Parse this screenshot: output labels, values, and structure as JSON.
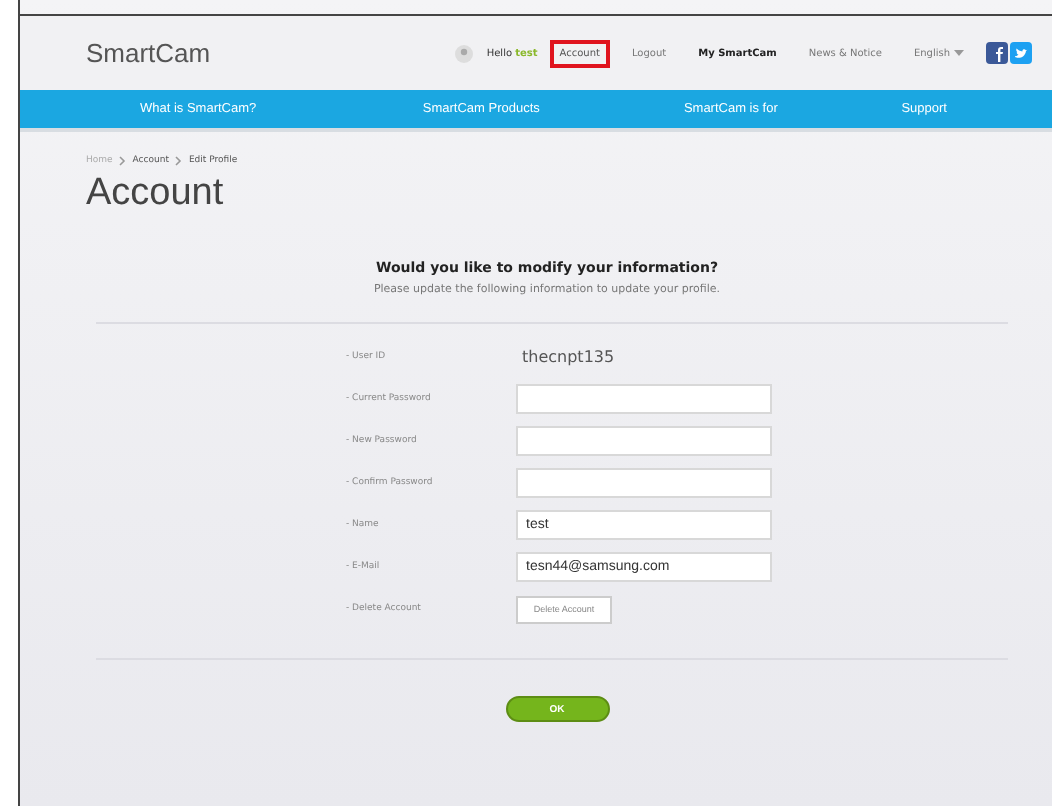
{
  "logo": "SmartCam",
  "header_links": [
    {
      "kind": "icon"
    },
    {
      "kind": "greeting",
      "label": "Hello",
      "user": "test"
    },
    {
      "kind": "link",
      "label": "Account",
      "selected": true
    },
    {
      "kind": "link",
      "label": "Logout",
      "selected": false
    },
    {
      "kind": "bold",
      "label": "My SmartCam"
    },
    {
      "kind": "link",
      "label": "News & Notice",
      "selected": false
    },
    {
      "kind": "dropdown",
      "label": "English"
    },
    {
      "kind": "social"
    }
  ],
  "nav": [
    "What is SmartCam?",
    "SmartCam Products",
    "SmartCam is for",
    "Support"
  ],
  "breadcrumb": [
    "Home",
    "Account",
    "Edit Profile"
  ],
  "title": "Account",
  "heading": "Would you like to modify your information?",
  "subheading": "Please update the following information to update your profile.",
  "fields": [
    {
      "kind": "text",
      "label": "- User ID",
      "value": "thecnpt135"
    },
    {
      "kind": "input",
      "label": "- Current Password"
    },
    {
      "kind": "input",
      "label": "- New Password"
    },
    {
      "kind": "input",
      "label": "- Confirm Password"
    },
    {
      "kind": "input",
      "label": "- Name",
      "value": "test"
    },
    {
      "kind": "input",
      "label": "- E-Mail",
      "value": "tesn44@samsung.com"
    },
    {
      "kind": "button",
      "label": "- Delete Account",
      "value": "Delete Account"
    }
  ],
  "submit": "OK"
}
